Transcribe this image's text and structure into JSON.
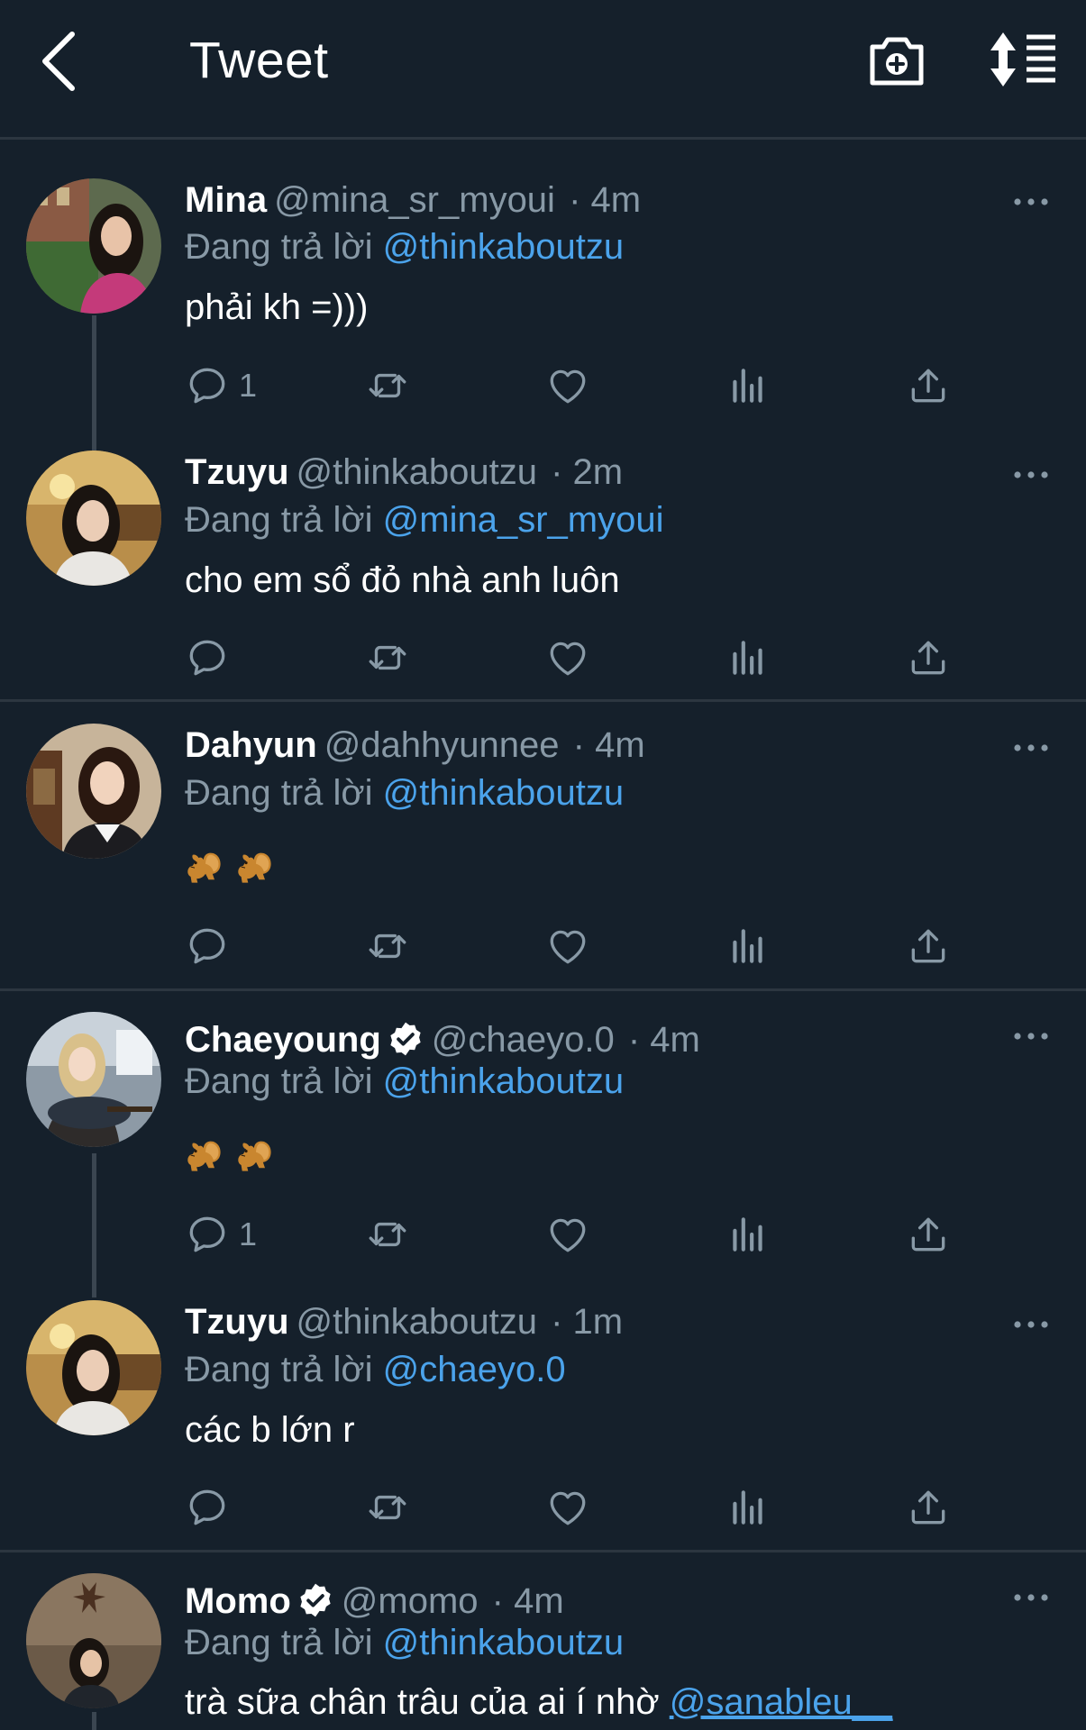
{
  "header": {
    "title": "Tweet",
    "back_icon": "chevron-left-icon",
    "camera_icon": "camera-plus-icon",
    "sort_icon": "sort-icon"
  },
  "reply_prefix": "Đang trả lời",
  "tweets": [
    {
      "name": "Mina",
      "handle": "@mina_sr_myoui",
      "time": "· 4m",
      "verified": false,
      "reply_to": "@thinkaboutzu",
      "text": "phải kh =)))",
      "reply_count": "1"
    },
    {
      "name": "Tzuyu",
      "handle": "@thinkaboutzu",
      "time": "· 2m",
      "verified": false,
      "reply_to": "@mina_sr_myoui",
      "text": "cho em sổ đỏ nhà anh luôn",
      "reply_count": ""
    },
    {
      "name": "Dahyun",
      "handle": "@dahhyunnee",
      "time": "· 4m",
      "verified": false,
      "reply_to": "@thinkaboutzu",
      "text": "",
      "emoji": "squirrel-emoji ×2",
      "reply_count": ""
    },
    {
      "name": "Chaeyoung",
      "handle": "@chaeyo.0",
      "time": "· 4m",
      "verified": true,
      "reply_to": "@thinkaboutzu",
      "text": "",
      "emoji": "squirrel-emoji ×2",
      "reply_count": "1"
    },
    {
      "name": "Tzuyu",
      "handle": "@thinkaboutzu",
      "time": "· 1m",
      "verified": false,
      "reply_to": "@chaeyo.0",
      "text": "các b lớn r",
      "reply_count": ""
    },
    {
      "name": "Momo",
      "handle": "@momo",
      "time": "· 4m",
      "verified": true,
      "reply_to": "@thinkaboutzu",
      "text": "trà sữa chân trâu của ai í nhờ",
      "text_mention": "@sanableu__",
      "reply_count": ""
    }
  ],
  "colors": {
    "background": "#15202b",
    "accent": "#4ba3eb",
    "muted": "#8899a6",
    "divider": "#2c3640"
  }
}
